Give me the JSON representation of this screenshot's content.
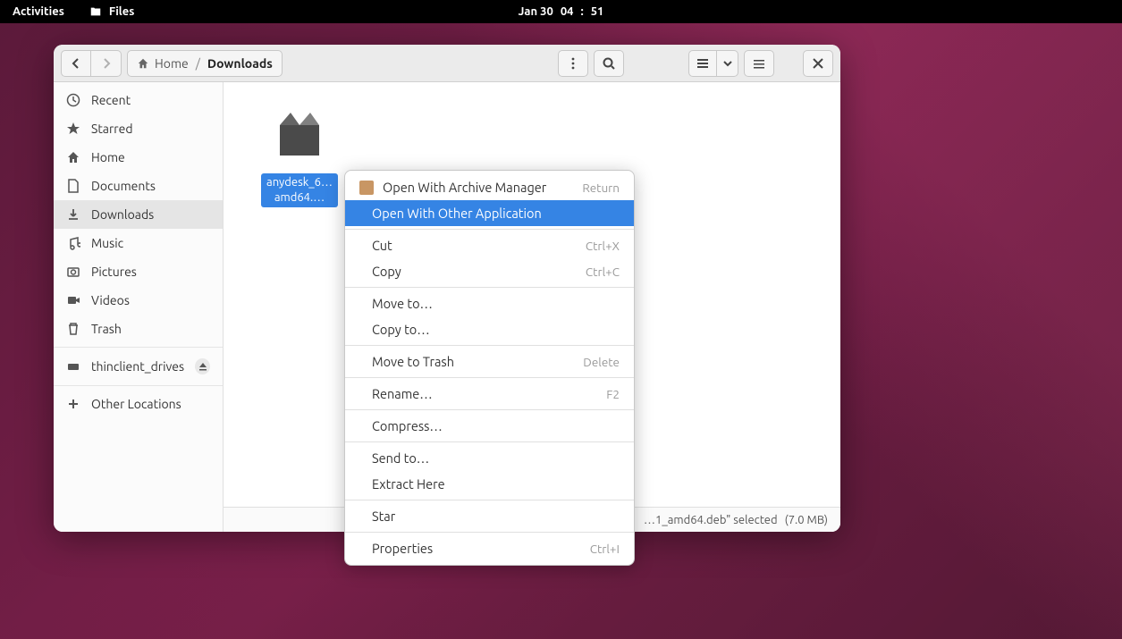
{
  "topbar": {
    "activities": "Activities",
    "app_label": "Files",
    "date": "Jan 30",
    "time_hour": "04",
    "time_min": "51"
  },
  "titlebar": {
    "path_home": "Home",
    "path_current": "Downloads"
  },
  "sidebar": {
    "recent": "Recent",
    "starred": "Starred",
    "home": "Home",
    "documents": "Documents",
    "downloads": "Downloads",
    "music": "Music",
    "pictures": "Pictures",
    "videos": "Videos",
    "trash": "Trash",
    "drive": "thinclient_drives",
    "other": "Other Locations"
  },
  "file": {
    "label_line1": "anydesk_6",
    "label_line2": "amd64."
  },
  "status": {
    "selected": "1_amd64.deb\" selected",
    "size": "(7.0 MB)"
  },
  "menu": {
    "open_archive": "Open With Archive Manager",
    "open_archive_accel": "Return",
    "open_other": "Open With Other Application",
    "cut": "Cut",
    "cut_accel": "Ctrl+X",
    "copy": "Copy",
    "copy_accel": "Ctrl+C",
    "move_to": "Move to…",
    "copy_to": "Copy to…",
    "trash": "Move to Trash",
    "trash_accel": "Delete",
    "rename": "Rename…",
    "rename_accel": "F2",
    "compress": "Compress…",
    "send_to": "Send to…",
    "extract": "Extract Here",
    "star": "Star",
    "properties": "Properties",
    "properties_accel": "Ctrl+I"
  }
}
